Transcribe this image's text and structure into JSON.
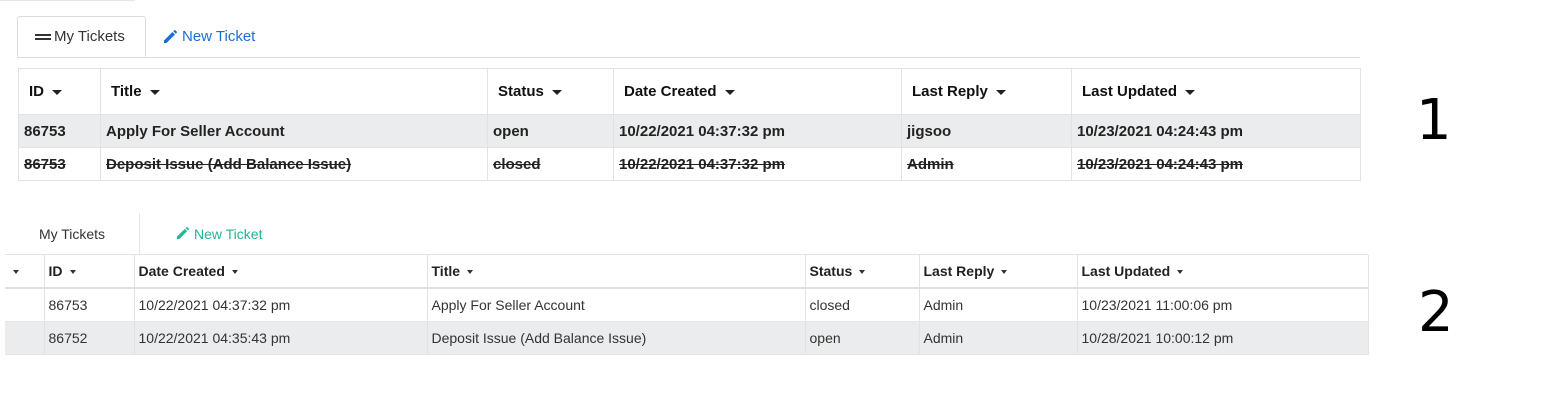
{
  "v1": {
    "tabs": {
      "my_tickets": "My Tickets",
      "new_ticket": "New Ticket"
    },
    "columns": [
      "ID",
      "Title",
      "Status",
      "Date Created",
      "Last Reply",
      "Last Updated"
    ],
    "rows": [
      {
        "id": "86753",
        "title": "Apply For Seller Account",
        "status": "open",
        "date_created": "10/22/2021 04:37:32 pm",
        "last_reply": "jigsoo",
        "last_updated": "10/23/2021 04:24:43 pm",
        "struck": false
      },
      {
        "id": "86753",
        "title": "Deposit Issue (Add Balance Issue)",
        "status": "closed",
        "date_created": "10/22/2021 04:37:32 pm",
        "last_reply": "Admin",
        "last_updated": "10/23/2021 04:24:43 pm",
        "struck": true
      }
    ],
    "accent": "#1a6fd6"
  },
  "v2": {
    "tabs": {
      "my_tickets": "My Tickets",
      "new_ticket": "New Ticket"
    },
    "columns": [
      "ID",
      "Date Created",
      "Title",
      "Status",
      "Last Reply",
      "Last Updated"
    ],
    "rows": [
      {
        "id": "86753",
        "date_created": "10/22/2021 04:37:32 pm",
        "title": "Apply For Seller Account",
        "status": "closed",
        "last_reply": "Admin",
        "last_updated": "10/23/2021 11:00:06 pm"
      },
      {
        "id": "86752",
        "date_created": "10/22/2021 04:35:43 pm",
        "title": "Deposit Issue (Add Balance Issue)",
        "status": "open",
        "last_reply": "Admin",
        "last_updated": "10/28/2021 10:00:12 pm"
      }
    ],
    "accent": "#27b394"
  },
  "markers": [
    "1",
    "2"
  ],
  "icons": {
    "my_tickets_v1": "hamburger-icon",
    "new_ticket": "pencil-icon",
    "sort": "caret-down-icon"
  }
}
